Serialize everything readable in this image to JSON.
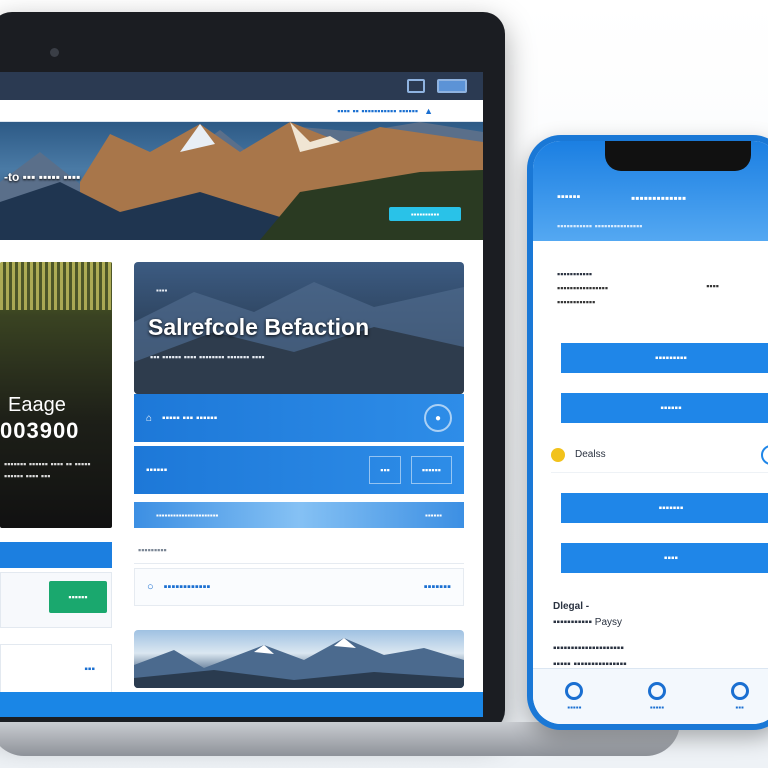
{
  "laptop": {
    "address_text": "▪▪▪▪ ▪▪ ▪▪▪▪▪▪▪▪▪▪▪ ▪▪▪▪▪▪",
    "hero": {
      "text": "-to ▪▪▪ ▪▪▪▪▪ ▪▪▪▪",
      "button": "▪▪▪▪▪▪▪▪▪▪"
    },
    "left_card": {
      "title": "Eaage",
      "number": "003900",
      "sub": "▪▪▪▪▪▪▪ ▪▪▪▪▪▪ ▪▪▪▪ ▪▪ ▪▪▪▪▪ ▪▪▪▪▪▪ ▪▪▪▪ ▪▪▪"
    },
    "left_green_button": "▪▪▪▪▪▪",
    "left_small_link": "▪▪▪",
    "feature": {
      "tag": "▪▪▪▪",
      "title": "Salrefcole Befaction",
      "sub": "▪▪▪ ▪▪▪▪▪▪ ▪▪▪▪ ▪▪▪▪▪▪▪▪ ▪▪▪▪▪▪▪ ▪▪▪▪"
    },
    "row1": {
      "label": "▪▪▪▪▪ ▪▪▪ ▪▪▪▪▪▪"
    },
    "row2": {
      "label": "▪▪▪▪▪▪",
      "pill1": "▪▪▪",
      "pill2": "▪▪▪▪▪▪"
    },
    "stripe": {
      "left": "▪▪▪▪▪▪▪▪▪▪▪▪▪▪▪▪▪▪▪▪▪▪",
      "right": "▪▪▪▪▪▪"
    },
    "plain_row": "▪▪▪▪▪▪▪▪▪",
    "link_row": {
      "left": "▪▪▪▪▪▪▪▪▪▪▪▪",
      "right": "▪▪▪▪▪▪▪"
    }
  },
  "phone": {
    "header": {
      "back": "▪▪▪▪▪▪",
      "title": "▪▪▪▪▪▪▪▪▪▪▪▪▪",
      "sub": "▪▪▪▪▪▪▪▪▪▪▪ ▪▪▪▪▪▪▪▪▪▪▪▪▪▪▪"
    },
    "info": {
      "l1": "▪▪▪▪▪▪▪▪▪▪▪",
      "l2": "▪▪▪▪▪▪▪▪▪▪▪▪▪▪▪▪",
      "l3": "▪▪▪▪▪▪▪▪▪▪▪▪",
      "right": "▪▪▪▪"
    },
    "btn1": "▪▪▪▪▪▪▪▪▪",
    "btn2": "▪▪▪▪▪▪",
    "item": "Dealss",
    "btn3": "▪▪▪▪▪▪▪",
    "btn4": "▪▪▪▪",
    "text": {
      "l1": "Dlegal -",
      "l2a": "▪▪▪▪▪▪▪▪▪▪▪",
      "l2b": "Paysy",
      "l3": "▪▪▪▪▪▪▪▪▪▪▪▪▪▪▪▪▪▪▪▪",
      "l4": "▪▪▪▪▪ ▪▪▪▪▪▪▪▪▪▪▪▪▪▪▪"
    },
    "nav": [
      {
        "label": "▪▪▪▪▪"
      },
      {
        "label": "▪▪▪▪▪"
      },
      {
        "label": "▪▪▪"
      }
    ]
  },
  "colors": {
    "accent": "#1f86e8",
    "dark": "#1b1d22",
    "green": "#1aa86e"
  }
}
